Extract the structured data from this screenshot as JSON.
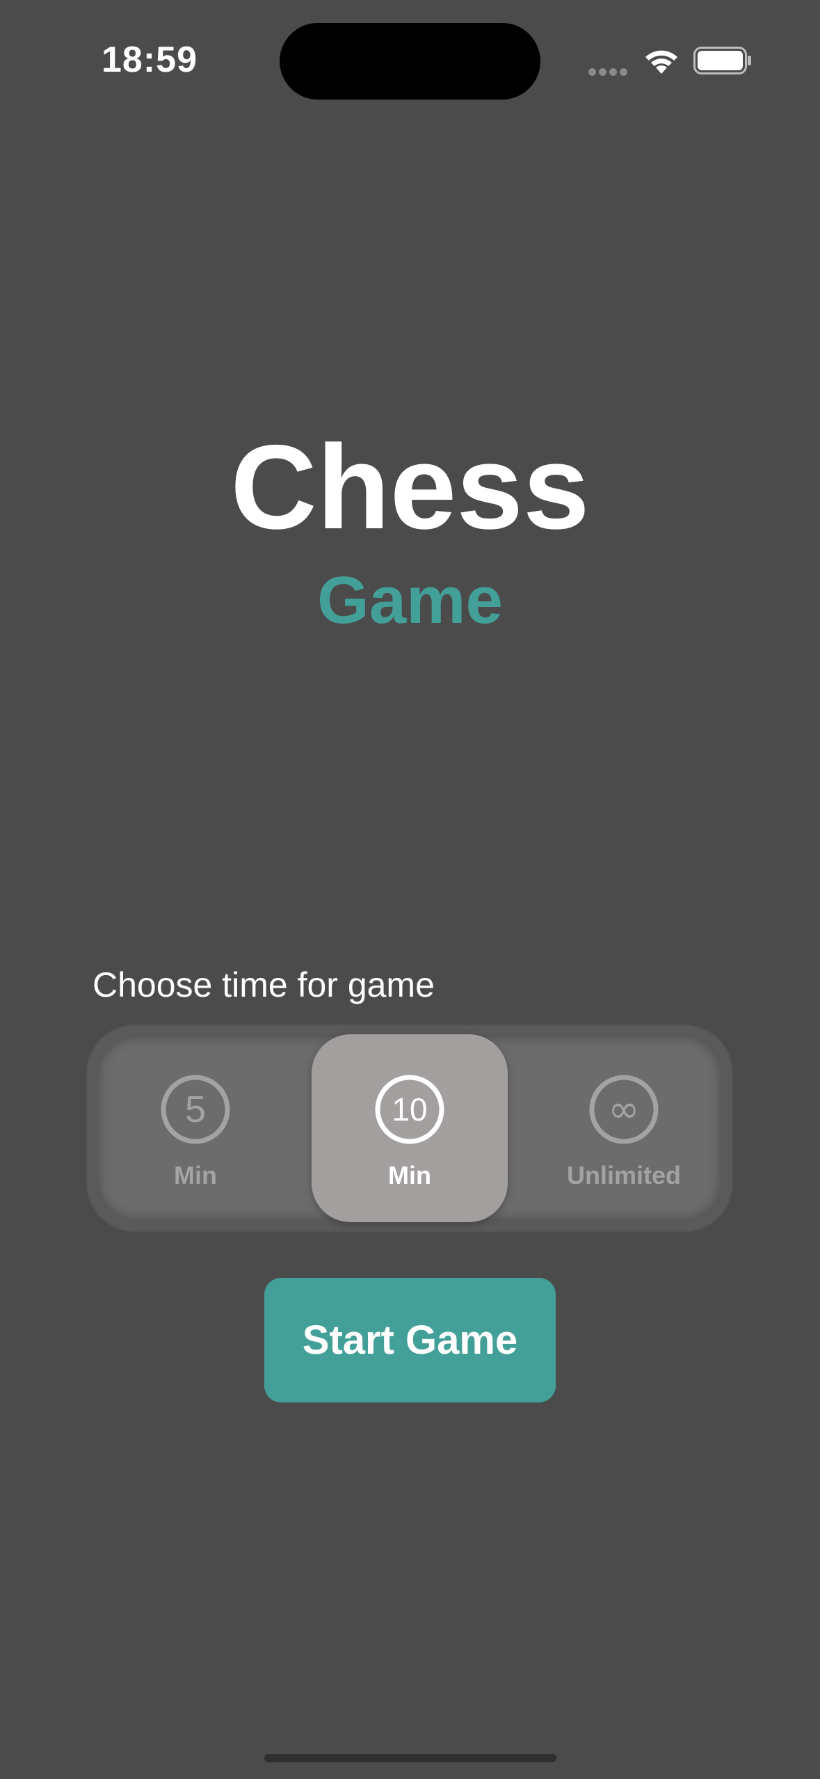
{
  "status_bar": {
    "time": "18:59",
    "icons": [
      "cellular-signal-icon",
      "wifi-icon",
      "battery-icon"
    ]
  },
  "header": {
    "title": "Chess",
    "subtitle": "Game"
  },
  "time_picker": {
    "label": "Choose time for game",
    "selected": "10",
    "options": [
      {
        "icon_text": "5",
        "label": "Min",
        "icon": "five-circle-icon"
      },
      {
        "icon_text": "10",
        "label": "Min",
        "icon": "ten-circle-icon"
      },
      {
        "icon_text": "∞",
        "label": "Unlimited",
        "icon": "infinity-circle-icon"
      }
    ]
  },
  "actions": {
    "start_label": "Start Game"
  },
  "colors": {
    "background": "#4b4b4b",
    "accent": "#43a098",
    "selected_option": "#a39f9e"
  }
}
